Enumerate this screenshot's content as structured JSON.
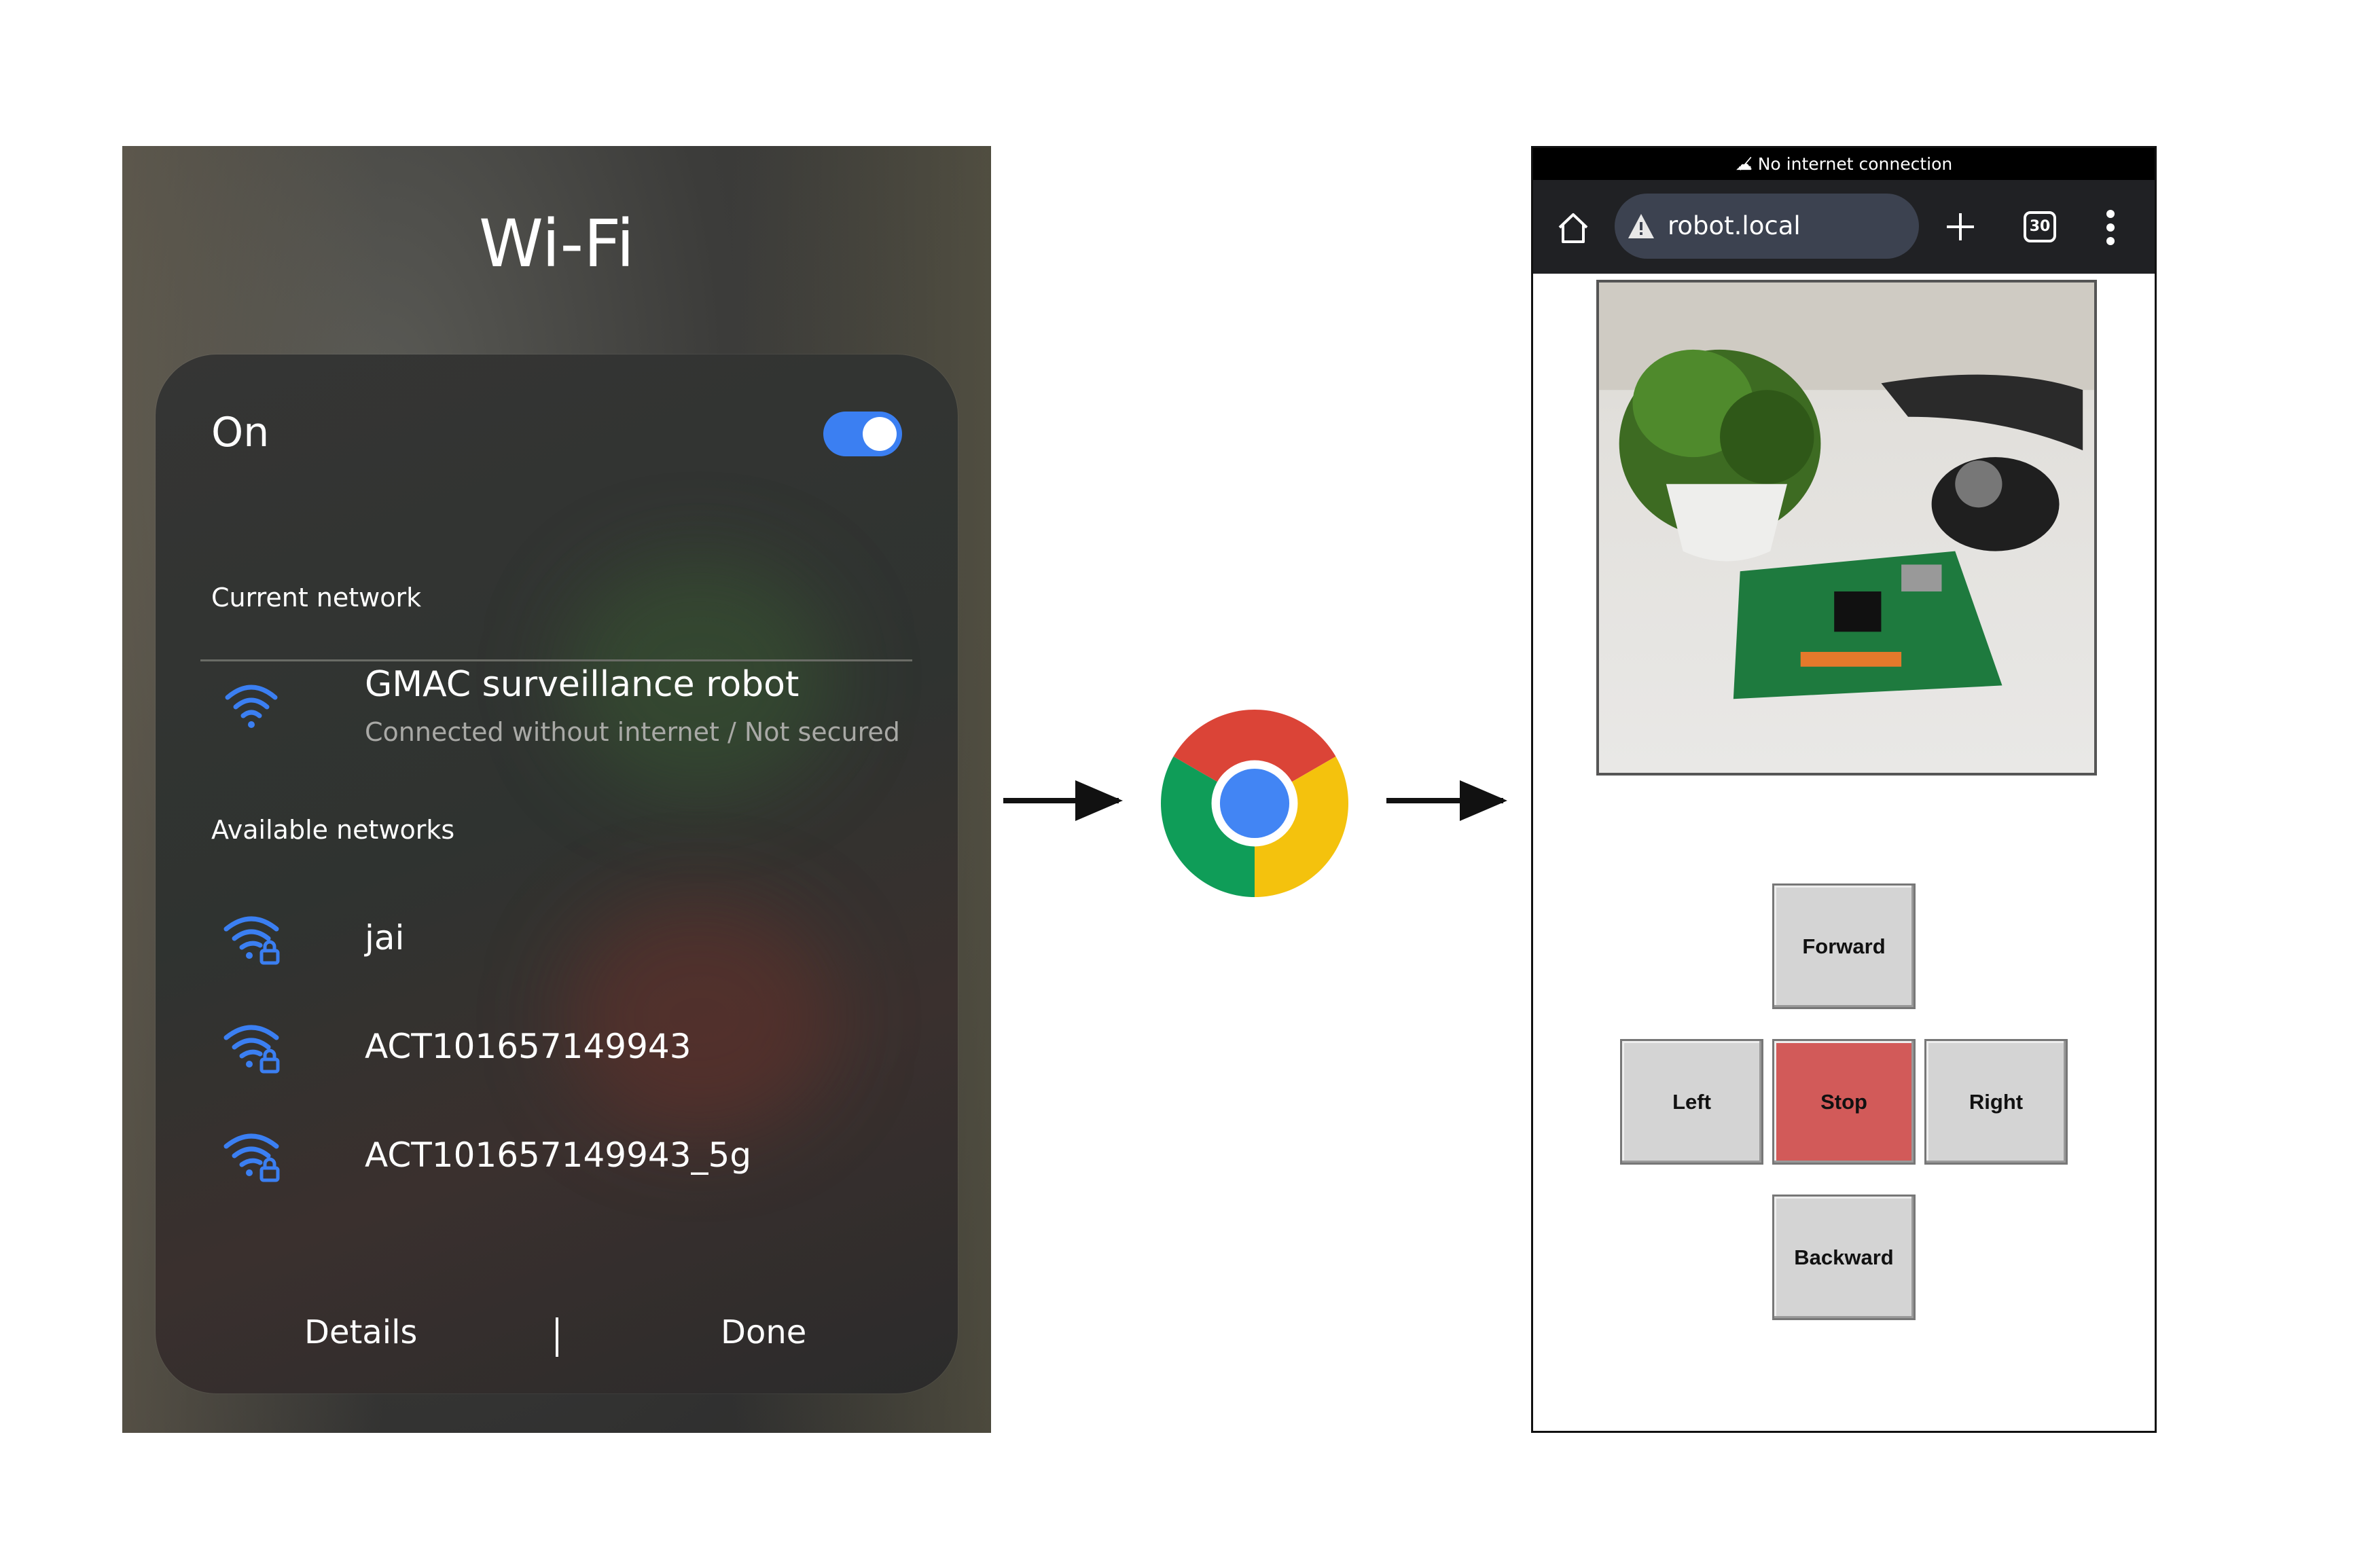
{
  "wifi_screen": {
    "title": "Wi-Fi",
    "toggle_label": "On",
    "toggle_on": true,
    "current_network_label": "Current network",
    "current_network": {
      "name": "GMAC surveillance robot",
      "status": "Connected without internet / Not secured",
      "icon": "wifi-icon"
    },
    "available_networks_label": "Available networks",
    "available_networks": [
      {
        "name": "jai",
        "icon": "wifi-lock-icon"
      },
      {
        "name": "ACT101657149943",
        "icon": "wifi-lock-icon"
      },
      {
        "name": "ACT101657149943_5g",
        "icon": "wifi-lock-icon"
      }
    ],
    "details_label": "Details",
    "done_label": "Done",
    "accent": "#3b7ff2"
  },
  "middle": {
    "icon": "chrome-logo"
  },
  "browser": {
    "status_text": "No internet connection",
    "url": "robot.local",
    "tab_count": "30",
    "controls": {
      "forward": "Forward",
      "left": "Left",
      "stop": "Stop",
      "right": "Right",
      "backward": "Backward"
    },
    "stop_color": "#d25a59"
  }
}
